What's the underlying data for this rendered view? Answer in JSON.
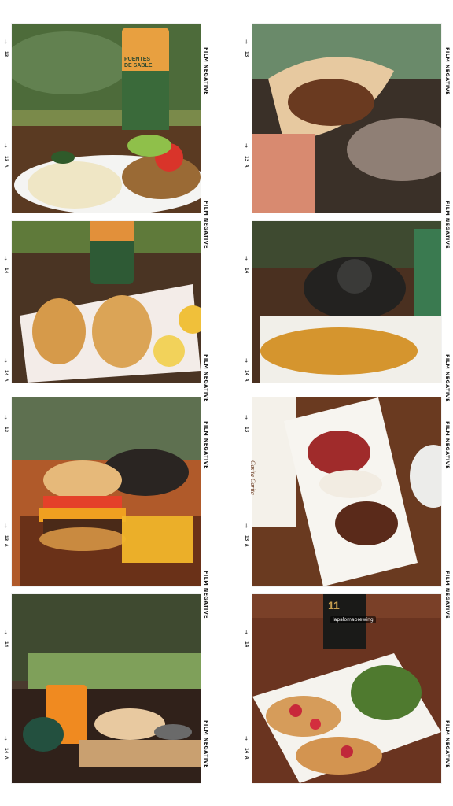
{
  "film_label": "FILM NEGATIVE",
  "frame_numbers": {
    "left": [
      "13",
      "13 A",
      "14",
      "14 A",
      "13",
      "13 A",
      "14",
      "14 A"
    ],
    "right": [
      "13",
      "13 A",
      "14",
      "14 A",
      "13",
      "13 A",
      "14",
      "14 A"
    ]
  },
  "arrow_glyph": "→",
  "photos": [
    {
      "column": "left",
      "row": 1,
      "subject": "Plate with mashed potatoes, breaded cutlet, salad and a beer can",
      "can_text": "PUENTES DE SABLE"
    },
    {
      "column": "left",
      "row": 2,
      "subject": "Two empanadas with lemon wedges on a white plate"
    },
    {
      "column": "left",
      "row": 3,
      "subject": "Burger with cheese and fries on a wooden board, vintage phone behind"
    },
    {
      "column": "left",
      "row": 4,
      "subject": "Breakfast table with orange juice, bread and small bowls"
    },
    {
      "column": "right",
      "row": 1,
      "subject": "Hand holding a bitten empanada"
    },
    {
      "column": "right",
      "row": 2,
      "subject": "Potato wedges with a black rotary phone and beer can"
    },
    {
      "column": "right",
      "row": 3,
      "subject": "Dessert plate with strawberries and a Casita Carita menu",
      "menu_text": "Casita Carita"
    },
    {
      "column": "right",
      "row": 4,
      "subject": "Bruschettas with tomatoes and green salad, beer bottle",
      "bottle_text": "11",
      "watermark": "lapalomabrewing"
    }
  ],
  "colors": {
    "background": "#ffffff",
    "label": "#1c1c1c"
  }
}
